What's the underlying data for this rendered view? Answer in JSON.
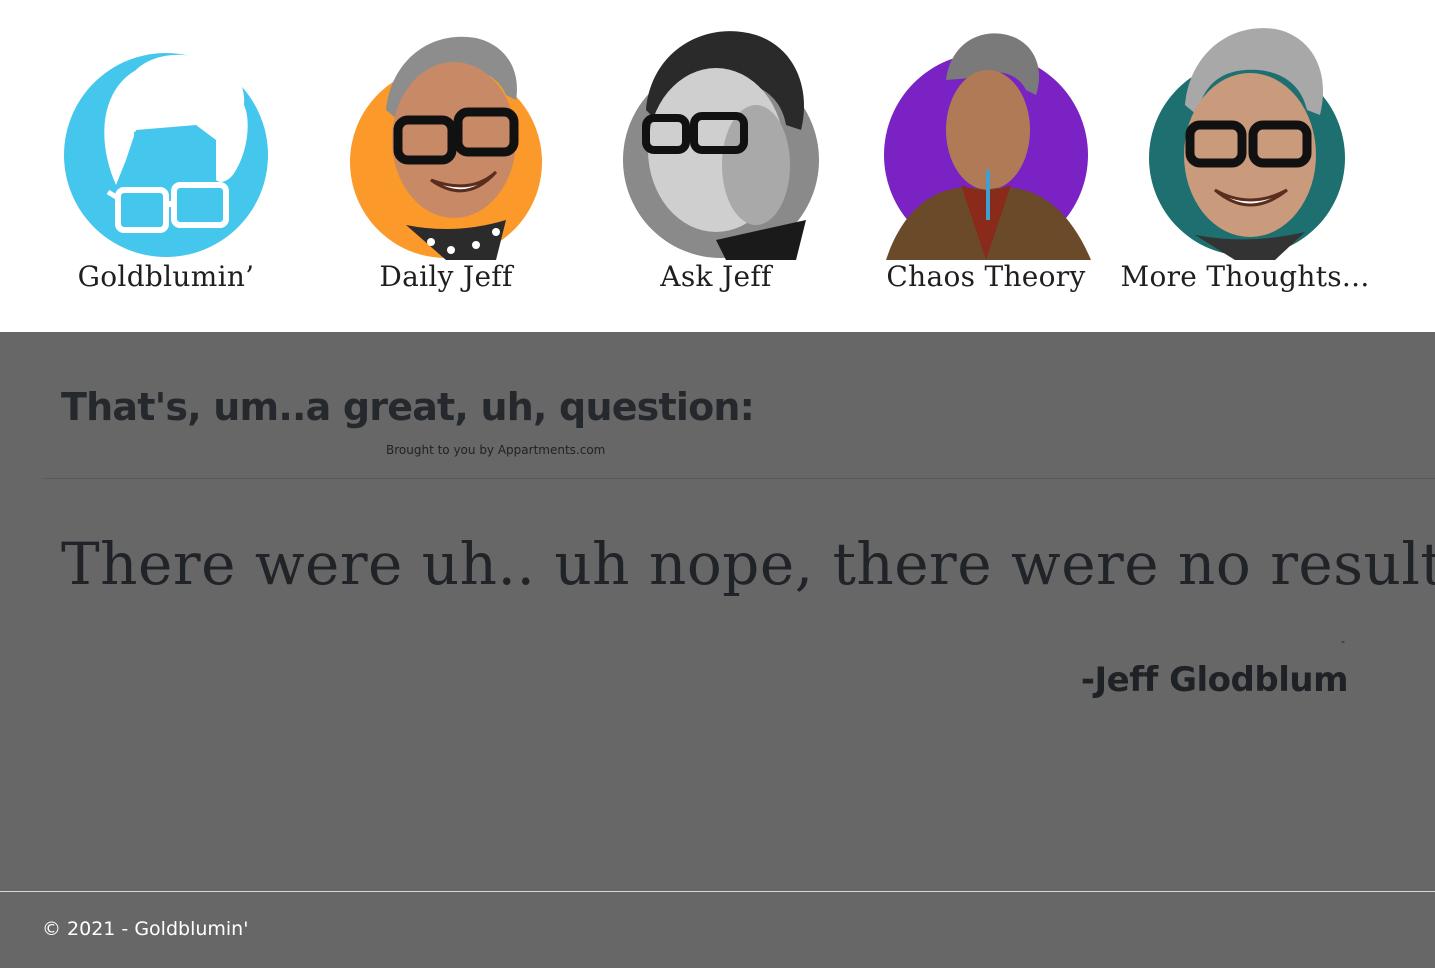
{
  "nav": {
    "items": [
      {
        "label": "Goldblumin’",
        "color": "#45c6ec"
      },
      {
        "label": "Daily Jeff",
        "color": "#fb9a2a"
      },
      {
        "label": "Ask Jeff",
        "color": "#8a8a8a"
      },
      {
        "label": "Chaos Theory",
        "color": "#7a22c4"
      },
      {
        "label": "More Thoughts...",
        "color": "#1e6f70"
      }
    ]
  },
  "main": {
    "heading": "That's, um..a great, uh, question:",
    "byline": "Brought to you by Appartments.com",
    "quote": "There were uh.. uh nope, there were no results.",
    "dash": "-",
    "attribution": "-Jeff Glodblum"
  },
  "footer": {
    "copyright": "© 2021 - Goldblumin'"
  }
}
